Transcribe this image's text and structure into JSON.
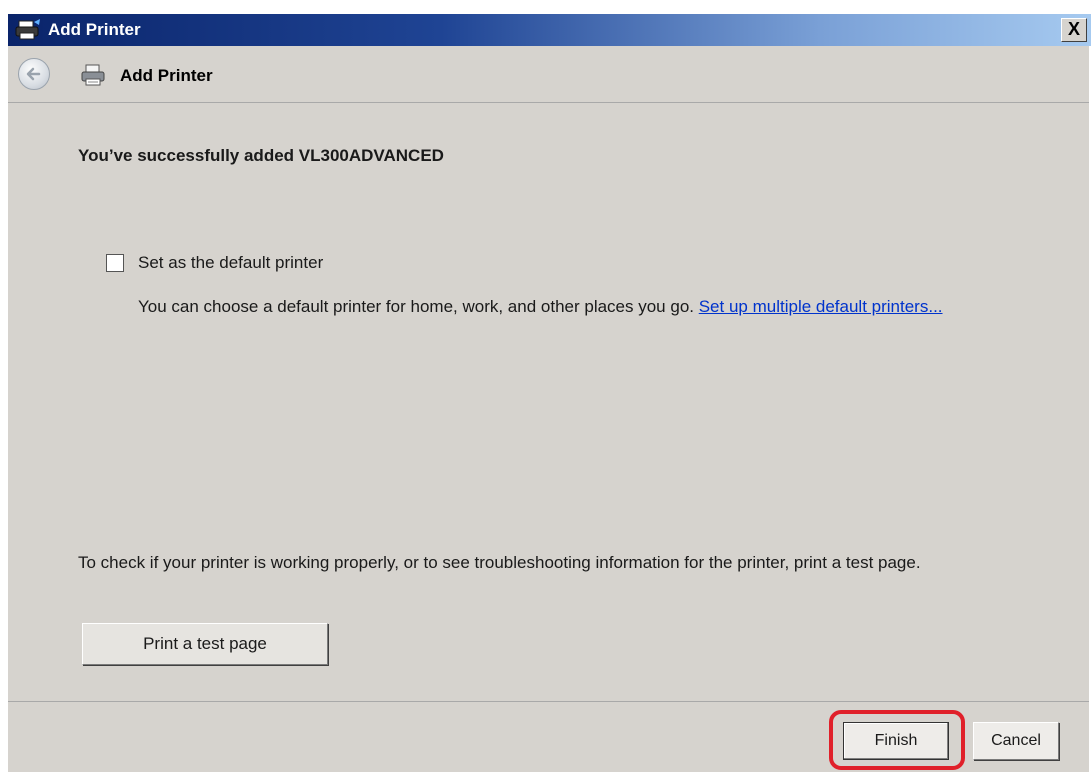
{
  "window": {
    "title": "Add Printer",
    "close_label": "X"
  },
  "nav": {
    "title": "Add Printer"
  },
  "content": {
    "heading": "You’ve successfully added VL300ADVANCED",
    "default_checkbox_label": "Set as the default printer",
    "default_checked": false,
    "info_text": "You can choose a default printer for home, work, and other places you go. ",
    "info_link": "Set up multiple default printers...",
    "test_text": "To check if your printer is working properly, or to see troubleshooting information for the printer, print a test page.",
    "test_button_label": "Print a test page"
  },
  "footer": {
    "finish_label": "Finish",
    "cancel_label": "Cancel"
  },
  "colors": {
    "highlight": "#e0202a",
    "link": "#0033cc"
  },
  "icons": {
    "title": "printer-icon",
    "nav_back": "back-arrow-icon",
    "nav": "printer-icon"
  }
}
